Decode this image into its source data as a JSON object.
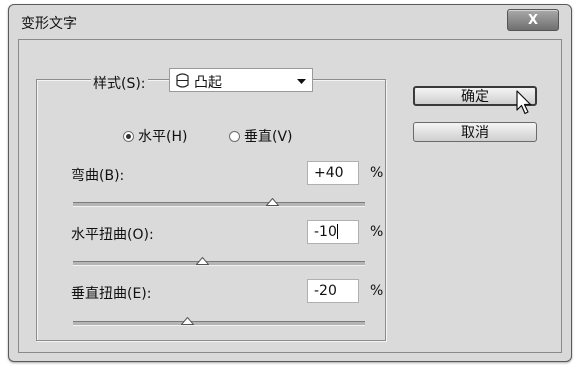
{
  "window": {
    "title": "变形文字",
    "close_label": "X"
  },
  "style": {
    "label": "样式(S):",
    "value": "凸起"
  },
  "orientation": {
    "horizontal": "水平(H)",
    "vertical": "垂直(V)",
    "selected": "horizontal"
  },
  "bend": {
    "label": "弯曲(B):",
    "value": "+40",
    "unit": "%"
  },
  "h_distort": {
    "label": "水平扭曲(O):",
    "value": "-10",
    "unit": "%"
  },
  "v_distort": {
    "label": "垂直扭曲(E):",
    "value": "-20",
    "unit": "%"
  },
  "buttons": {
    "ok": "确定",
    "cancel": "取消"
  },
  "icons": {
    "style_shape": "bulge-shape-icon",
    "dropdown": "chevron-down-icon",
    "cursor": "mouse-pointer-icon"
  }
}
